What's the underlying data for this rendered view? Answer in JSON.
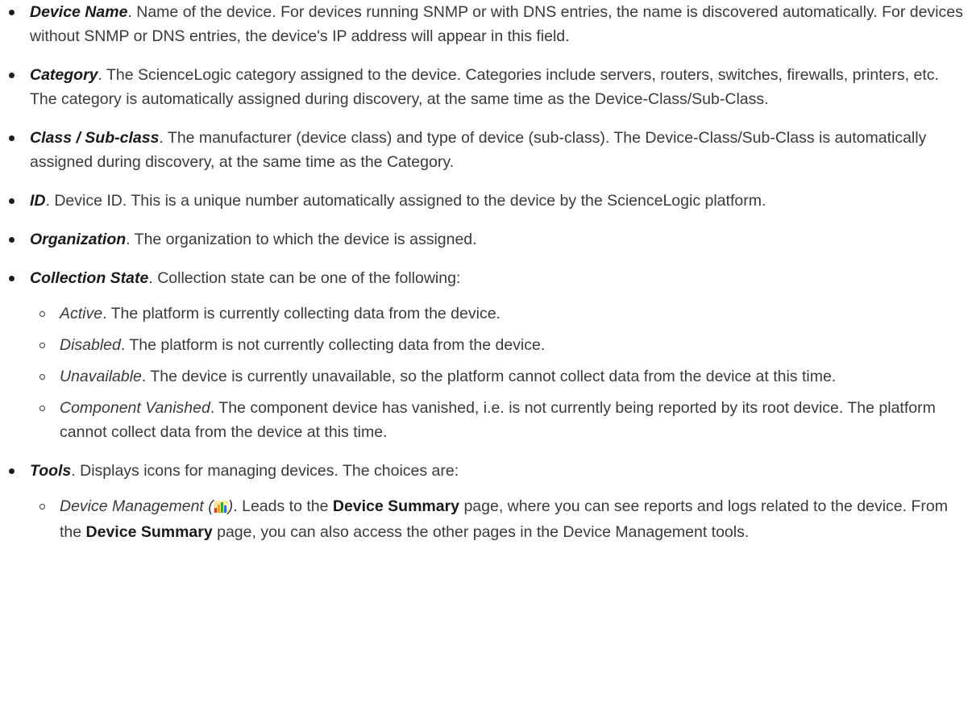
{
  "items": [
    {
      "term": "Device Name",
      "text": ". Name of the device. For devices running SNMP or with DNS entries, the name is discovered automatically. For devices without SNMP or DNS entries, the device's IP address will appear in this field."
    },
    {
      "term": "Category",
      "text": ". The ScienceLogic category assigned to the device. Categories include servers, routers, switches, firewalls, printers, etc. The category is automatically assigned during discovery, at the same time as the Device-Class/Sub-Class."
    },
    {
      "term": "Class / Sub-class",
      "text": ". The manufacturer (device class) and type of device (sub-class). The Device-Class/Sub-Class is automatically assigned during discovery, at the same time as the Category."
    },
    {
      "term": "ID",
      "text": ". Device ID. This is a unique number automatically assigned to the device by the ScienceLogic platform."
    },
    {
      "term": "Organization",
      "text": ". The organization to which the device is assigned."
    },
    {
      "term": "Collection State",
      "text": ". Collection state can be one of the following:"
    },
    {
      "term": "Tools",
      "text": ". Displays icons for managing devices. The choices are:"
    }
  ],
  "collection_states": [
    {
      "term": "Active",
      "text": ". The platform is currently collecting data from the device."
    },
    {
      "term": "Disabled",
      "text": ". The platform is not currently collecting data from the device."
    },
    {
      "term": "Unavailable",
      "text": ". The device is currently unavailable, so the platform cannot collect data from the device at this time."
    },
    {
      "term": "Component Vanished",
      "text": ". The component device has vanished, i.e. is not currently being reported by its root device. The platform cannot collect data from the device at this time."
    }
  ],
  "tools": [
    {
      "term": "Device Management (",
      "term_close": ")",
      "icon": "device-management-bar-chart-icon",
      "text_1": ". Leads to the ",
      "bold_1": "Device Summary",
      "text_2": " page, where you can see reports and logs related to the device. From the ",
      "bold_2": "Device Summary",
      "text_3": " page, you can also access the other pages in the Device Management tools."
    }
  ]
}
